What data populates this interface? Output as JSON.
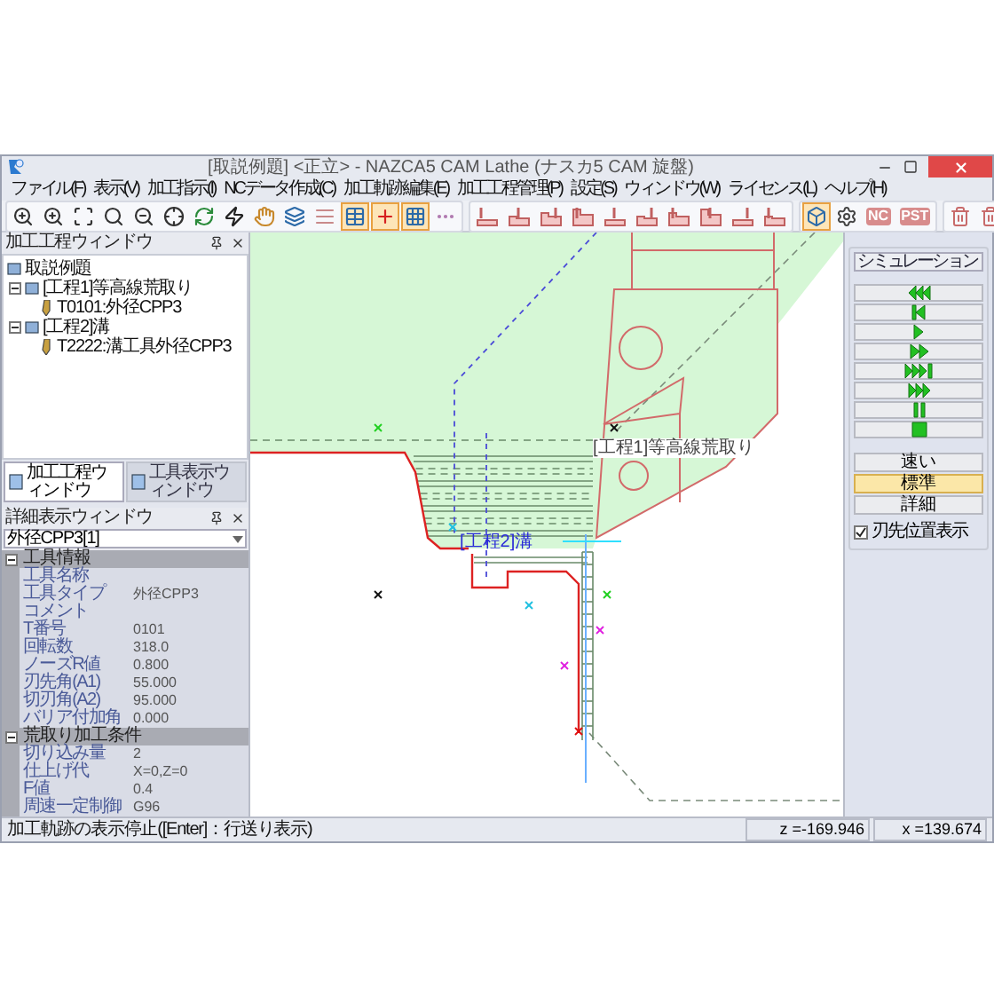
{
  "window": {
    "title": "[取説例題] <正立> - NAZCA5 CAM Lathe (ナスカ5 CAM 旋盤)"
  },
  "menu": [
    "ファイル(F)",
    "表示(V)",
    "加工指示(I)",
    "NCデータ作成(C)",
    "加工軌跡編集(E)",
    "加工工程管理(P)",
    "設定(S)",
    "ウィンドウ(W)",
    "ライセンス(L)",
    "ヘルプ(H)"
  ],
  "toolbar": [
    [
      {
        "selected": false
      },
      {
        "selected": false
      },
      {
        "selected": false
      },
      {
        "selected": false
      },
      {
        "selected": false
      },
      {
        "selected": false
      },
      {
        "selected": false
      },
      {
        "selected": false
      },
      {
        "selected": false
      },
      {
        "selected": false
      },
      {
        "selected": false
      },
      {
        "selected": true
      },
      {
        "selected": true
      },
      {
        "selected": true
      },
      {
        "selected": false
      }
    ],
    [
      {
        "selected": false
      },
      {
        "selected": false
      },
      {
        "selected": false
      },
      {
        "selected": false
      },
      {
        "selected": false
      },
      {
        "selected": false
      },
      {
        "selected": false
      },
      {
        "selected": false
      },
      {
        "selected": false
      },
      {
        "selected": false
      }
    ],
    [
      {
        "selected": true
      },
      {
        "selected": false
      },
      {
        "label": "NC",
        "selected": false
      },
      {
        "label": "PST",
        "selected": false
      }
    ],
    [
      {
        "selected": false
      },
      {
        "selected": false
      }
    ]
  ],
  "process_window": {
    "title": "加工工程ウィンドウ",
    "tree": [
      {
        "label": "取説例題",
        "children": [
          {
            "label": "[工程1]等高線荒取り",
            "expanded": true,
            "children": [
              {
                "label": "T0101:外径CPP3"
              }
            ]
          },
          {
            "label": "[工程2]溝",
            "expanded": true,
            "children": [
              {
                "label": "T2222:溝工具外径CPP3"
              }
            ]
          }
        ]
      }
    ],
    "tabs": [
      {
        "label": "加工工程ウィンドウ",
        "selected": true
      },
      {
        "label": "工具表示ウィンドウ",
        "selected": false
      }
    ]
  },
  "detail_window": {
    "title": "詳細表示ウィンドウ",
    "selector": "外径CPP3[1]",
    "sections": [
      {
        "title": "工具情報",
        "expanded": true,
        "rows": [
          {
            "name": "工具名称"
          },
          {
            "name": "工具タイプ",
            "value": "外径CPP3"
          },
          {
            "name": "コメント"
          },
          {
            "name": "T番号",
            "value": "0101"
          },
          {
            "name": "回転数",
            "value": "318.0"
          },
          {
            "name": "ノーズR値",
            "value": "0.800"
          },
          {
            "name": "刃先角(A1)",
            "value": "55.000"
          },
          {
            "name": "切刃角(A2)",
            "value": "95.000"
          },
          {
            "name": "バリア付加角",
            "value": "0.000"
          }
        ]
      },
      {
        "title": "荒取り加工条件",
        "expanded": true,
        "rows": [
          {
            "name": "切り込み量",
            "value": "2"
          },
          {
            "name": "仕上げ代",
            "value": "X=0,Z=0"
          },
          {
            "name": "F値",
            "value": "0.4"
          },
          {
            "name": "周速一定制御",
            "value": "G96"
          }
        ]
      }
    ]
  },
  "canvas": {
    "labels": [
      {
        "text": "[工程1]等高線荒取り",
        "kind": "roughing"
      },
      {
        "text": "[工程2]溝",
        "kind": "groove"
      }
    ]
  },
  "simulation": {
    "title": "シミュレーション",
    "speeds": [
      {
        "label": "速い",
        "selected": false
      },
      {
        "label": "標準",
        "selected": true
      },
      {
        "label": "詳細",
        "selected": false
      }
    ],
    "tip_display": {
      "label": "刃先位置表示",
      "checked": true
    }
  },
  "status_bar": {
    "message": "加工軌跡の表示停止([Enter]：行送り表示)",
    "z": "z =-169.946",
    "x": "x =139.674"
  }
}
